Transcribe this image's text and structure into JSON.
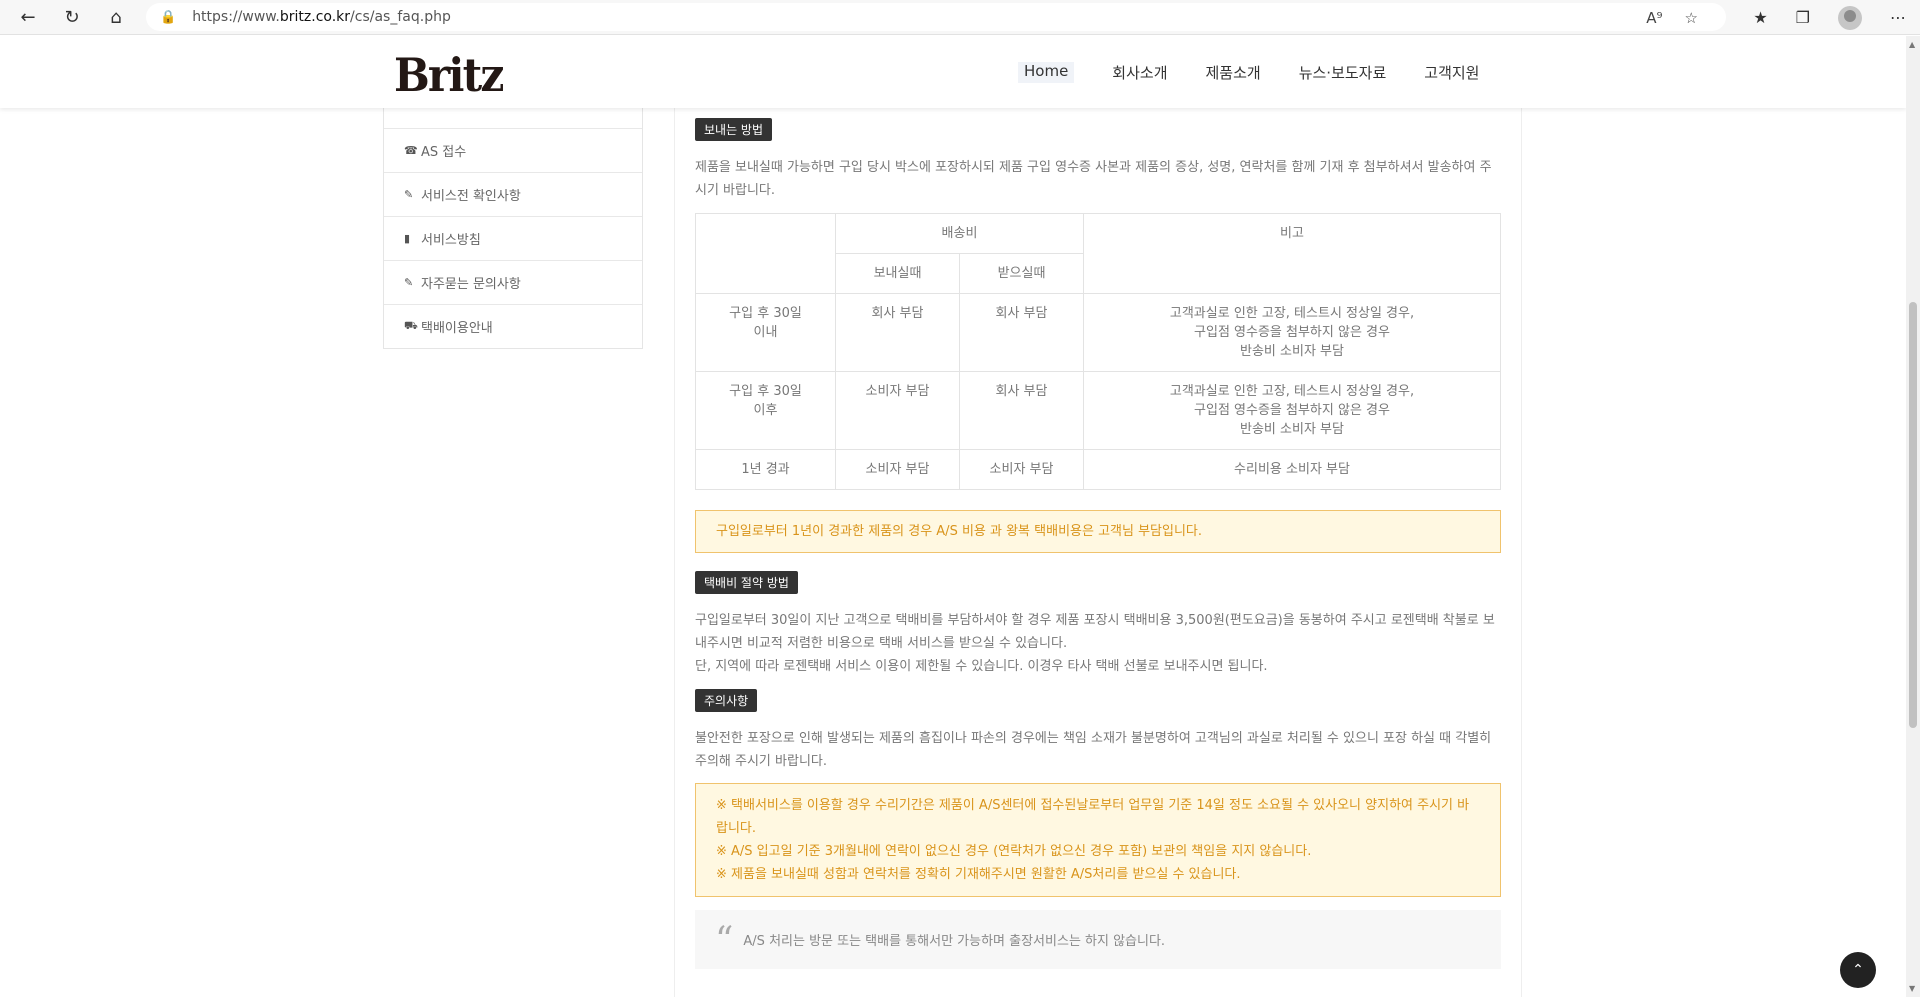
{
  "browser": {
    "url_prefix": "https://www.",
    "url_domain": "britz.co.kr",
    "url_path": "/cs/as_faq.php"
  },
  "header": {
    "logo": "Britz",
    "nav": [
      "Home",
      "회사소개",
      "제품소개",
      "뉴스·보도자료",
      "고객지원"
    ]
  },
  "sidebar": {
    "items": [
      {
        "label": "AS 접수",
        "icon": "phone-icon"
      },
      {
        "label": "서비스전 확인사항",
        "icon": "edit-icon"
      },
      {
        "label": "서비스방침",
        "icon": "file-icon"
      },
      {
        "label": "자주묻는 문의사항",
        "icon": "edit-icon"
      },
      {
        "label": "택배이용안내",
        "icon": "truck-icon"
      }
    ]
  },
  "content": {
    "send_method": {
      "tag": "보내는 방법",
      "text": "제품을 보내실때 가능하면 구입 당시 박스에 포장하시되 제품 구입 영수증 사본과 제품의 증상, 성명, 연락처를 함께 기재 후 첨부하셔서 발송하여 주시기 바랍니다."
    },
    "table": {
      "head_shipping": "배송비",
      "head_remark": "비고",
      "head_send": "보내실때",
      "head_receive": "받으실때",
      "rows": [
        {
          "period_1": "구입 후 30일",
          "period_2": "이내",
          "send": "회사 부담",
          "receive": "회사 부담",
          "remark_1": "고객과실로 인한 고장, 테스트시 정상일 경우,",
          "remark_2": "구입점 영수증을 첨부하지 않은 경우",
          "remark_3": "반송비 소비자 부담"
        },
        {
          "period_1": "구입 후 30일",
          "period_2": "이후",
          "send": "소비자 부담",
          "receive": "회사 부담",
          "remark_1": "고객과실로 인한 고장, 테스트시 정상일 경우,",
          "remark_2": "구입점 영수증을 첨부하지 않은 경우",
          "remark_3": "반송비 소비자 부담"
        },
        {
          "period_1": "1년 경과",
          "period_2": "",
          "send": "소비자 부담",
          "receive": "소비자 부담",
          "remark_1": "수리비용 소비자 부담",
          "remark_2": "",
          "remark_3": ""
        }
      ]
    },
    "notice_year": "구입일로부터 1년이 경과한 제품의 경우 A/S 비용 과 왕복 택배비용은 고객님 부담입니다.",
    "saving": {
      "tag": "택배비 절약 방법",
      "line1": "구입일로부터 30일이 지난 고객으로 택배비를 부담하셔야 할 경우 제품 포장시 택배비용 3,500원(편도요금)을 동봉하여 주시고 로젠택배 착불로 보내주시면 비교적 저렴한 비용으로 택배 서비스를 받으실 수 있습니다.",
      "line2": "단, 지역에 따라 로젠택배 서비스 이용이 제한될 수 있습니다. 이경우 타사 택배 선불로 보내주시면 됩니다."
    },
    "caution": {
      "tag": "주의사항",
      "text": "불안전한 포장으로 인해 발생되는 제품의 흠집이나 파손의 경우에는 책임 소재가 불분명하여 고객님의 과실로 처리될 수 있으니 포장 하실 때 각별히 주의해 주시기 바랍니다."
    },
    "notes": [
      "※ 택배서비스를 이용할 경우 수리기간은 제품이 A/S센터에 접수된날로부터 업무일 기준 14일 정도 소요될 수 있사오니 양지하여 주시기 바랍니다.",
      "※ A/S 입고일 기준 3개월내에 연락이 없으신 경우 (연락처가 없으신 경우 포함) 보관의 책임을 지지 않습니다.",
      "※ 제품을 보내실때 성함과 연락처를 정확히 기재해주시면 원활한 A/S처리를 받으실 수 있습니다."
    ],
    "quote": "A/S 처리는 방문 또는 택배를 통해서만 가능하며 출장서비스는 하지 않습니다."
  }
}
